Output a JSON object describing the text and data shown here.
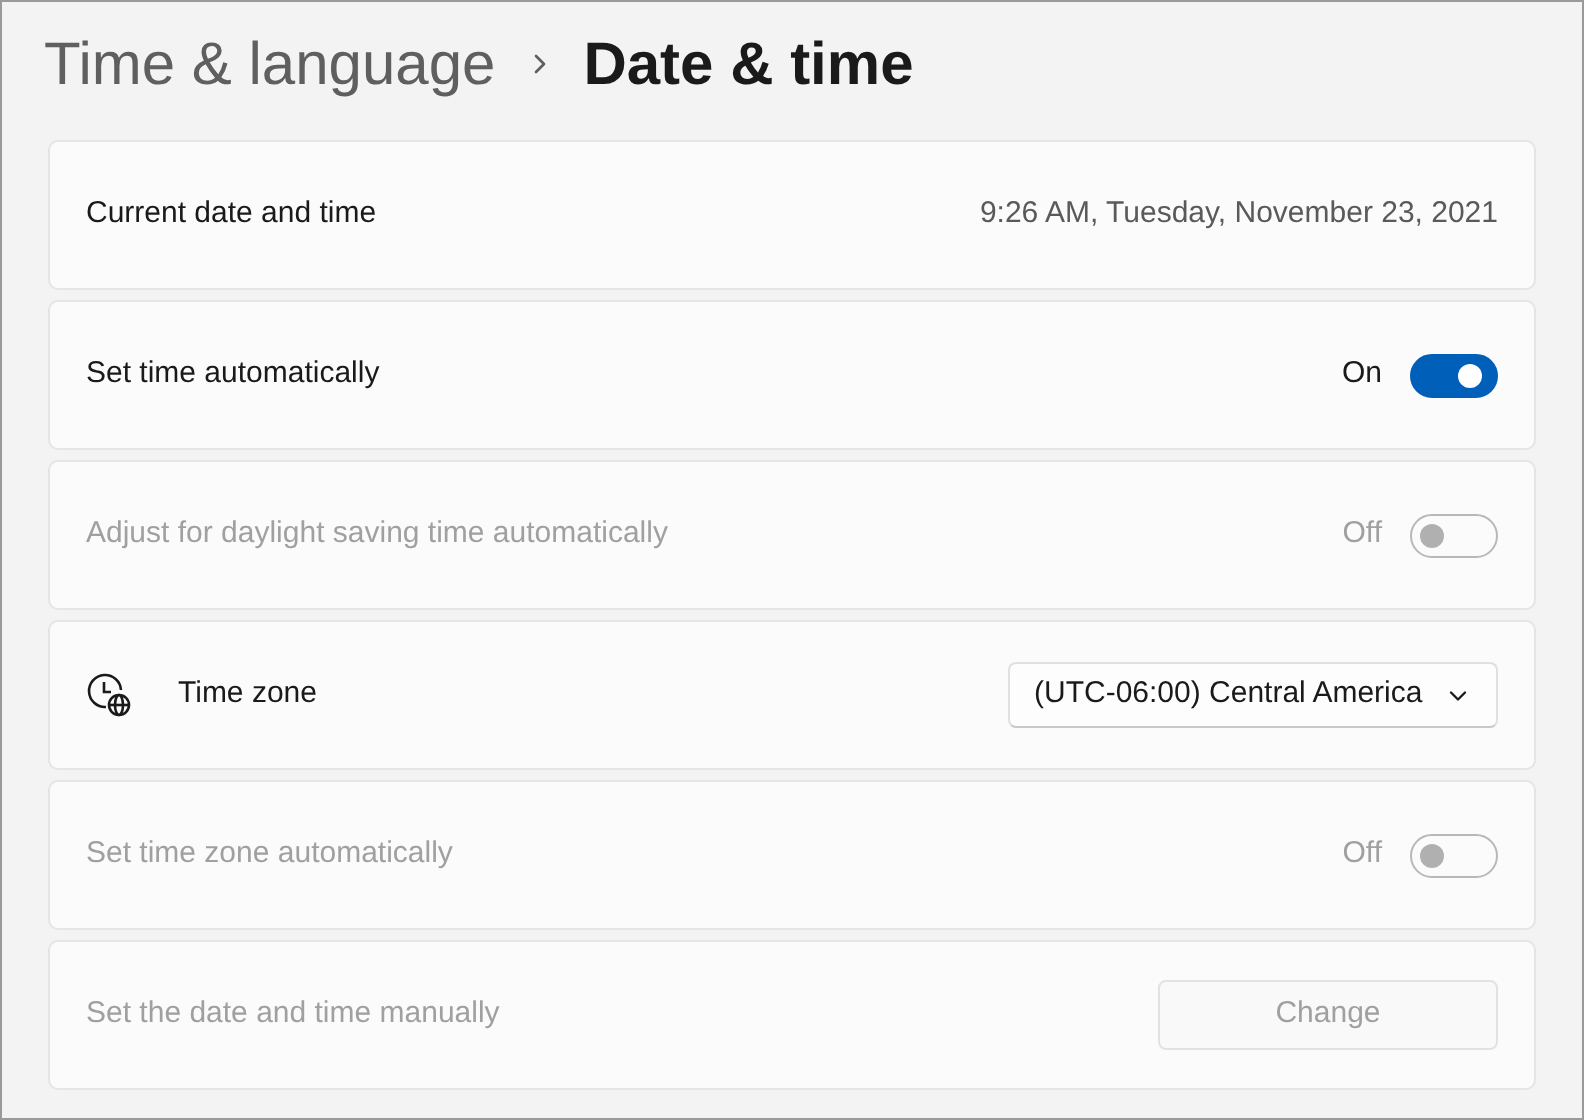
{
  "breadcrumb": {
    "parent": "Time & language",
    "current": "Date & time"
  },
  "rows": [
    {
      "kind": "value",
      "label": "Current date and time",
      "disabled": false,
      "value": "9:26 AM, Tuesday, November 23, 2021"
    },
    {
      "kind": "toggle",
      "label": "Set time automatically",
      "disabled": false,
      "on": true,
      "state_text": "On"
    },
    {
      "kind": "toggle",
      "label": "Adjust for daylight saving time automatically",
      "disabled": true,
      "on": false,
      "state_text": "Off"
    },
    {
      "kind": "dropdown",
      "label": "Time zone",
      "disabled": false,
      "value": "(UTC-06:00) Central America"
    },
    {
      "kind": "toggle",
      "label": "Set time zone automatically",
      "disabled": true,
      "on": false,
      "state_text": "Off"
    },
    {
      "kind": "button",
      "label": "Set the date and time manually",
      "disabled": true,
      "button": "Change"
    }
  ]
}
